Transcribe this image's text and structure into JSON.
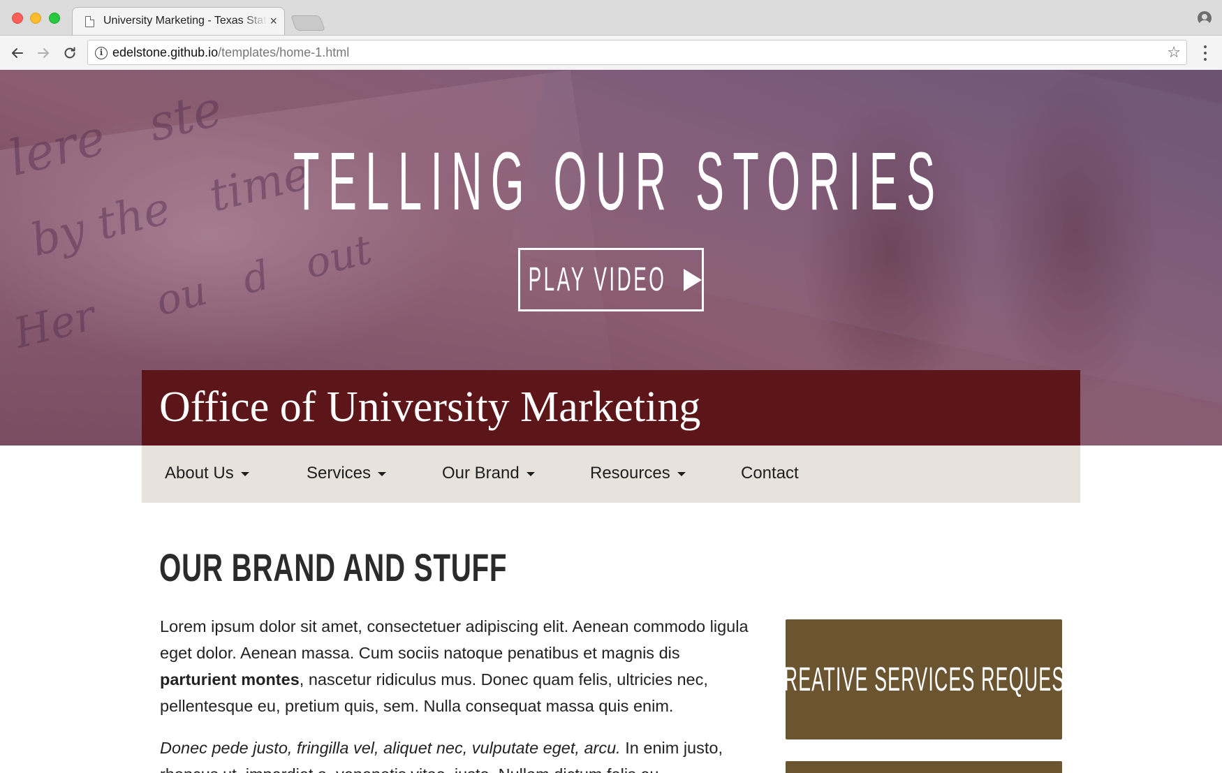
{
  "browser": {
    "tab_title": "University Marketing - Texas State",
    "tab_close": "×",
    "url_host": "edelstone.github.io",
    "url_path": "/templates/home-1.html",
    "star": "☆"
  },
  "hero": {
    "title": "TELLING OUR STORIES",
    "play_button": "PLAY VIDEO"
  },
  "banner": {
    "title": "Office of University Marketing"
  },
  "nav": {
    "items": [
      {
        "label": "About Us"
      },
      {
        "label": "Services"
      },
      {
        "label": "Our Brand"
      },
      {
        "label": "Resources"
      },
      {
        "label": "Contact"
      }
    ]
  },
  "content": {
    "heading": "OUR BRAND AND STUFF",
    "p1_start": "Lorem ipsum dolor sit amet, consectetuer adipiscing elit. Aenean commodo ligula eget dolor. Aenean massa. Cum sociis natoque penatibus et magnis dis ",
    "p1_bold": "parturient montes",
    "p1_end": ", nascetur ridiculus mus. Donec quam felis, ultricies nec, pellentesque eu, pretium quis, sem. Nulla consequat massa quis enim.",
    "p2_italic": "Donec pede justo, fringilla vel, aliquet nec, vulputate eget, arcu.",
    "p2_rest": " In enim justo, rhoncus ut, imperdiet a, venenatis vitae, justo. Nullam dictum felis eu"
  },
  "sidebar": {
    "cta_label": "CREATIVE SERVICES REQUEST"
  }
}
